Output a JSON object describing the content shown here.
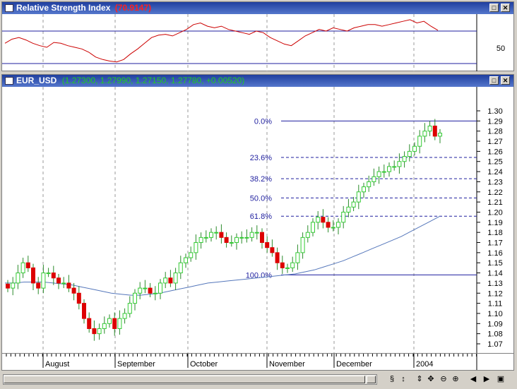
{
  "rsi_pane": {
    "title": "Relative Strength Index",
    "value_text": "(70.9147)",
    "axis_label": "50",
    "buttons": {
      "restore": "□",
      "close": "✕"
    }
  },
  "price_pane": {
    "title": "EUR_USD",
    "quote_text": "(1.27300, 1.27990, 1.27150, 1.27780, +0.00520)",
    "buttons": {
      "restore": "□",
      "close": "✕"
    }
  },
  "chart_data": {
    "type": "candlestick",
    "symbol": "EUR_USD",
    "y_ticks": [
      "1.30",
      "1.29",
      "1.28",
      "1.27",
      "1.26",
      "1.25",
      "1.24",
      "1.23",
      "1.22",
      "1.21",
      "1.20",
      "1.19",
      "1.18",
      "1.17",
      "1.16",
      "1.15",
      "1.14",
      "1.13",
      "1.12",
      "1.11",
      "1.10",
      "1.09",
      "1.08",
      "1.07"
    ],
    "ylim": [
      1.06,
      1.31
    ],
    "x_labels": [
      "August",
      "September",
      "October",
      "November",
      "December",
      "2004"
    ],
    "fibonacci": [
      {
        "label": "0.0%",
        "value": 1.29
      },
      {
        "label": "23.6%",
        "value": 1.254
      },
      {
        "label": "38.2%",
        "value": 1.233
      },
      {
        "label": "50.0%",
        "value": 1.214
      },
      {
        "label": "61.8%",
        "value": 1.196
      },
      {
        "label": "100.0%",
        "value": 1.138
      }
    ],
    "close_series": [
      1.125,
      1.13,
      1.14,
      1.15,
      1.145,
      1.13,
      1.125,
      1.14,
      1.14,
      1.135,
      1.13,
      1.13,
      1.125,
      1.12,
      1.11,
      1.095,
      1.085,
      1.08,
      1.085,
      1.09,
      1.095,
      1.085,
      1.095,
      1.1,
      1.11,
      1.12,
      1.125,
      1.125,
      1.12,
      1.12,
      1.13,
      1.135,
      1.13,
      1.14,
      1.15,
      1.155,
      1.16,
      1.17,
      1.175,
      1.175,
      1.18,
      1.18,
      1.175,
      1.17,
      1.17,
      1.175,
      1.175,
      1.175,
      1.18,
      1.18,
      1.17,
      1.165,
      1.16,
      1.15,
      1.145,
      1.145,
      1.15,
      1.16,
      1.175,
      1.18,
      1.19,
      1.195,
      1.19,
      1.185,
      1.185,
      1.19,
      1.2,
      1.205,
      1.21,
      1.22,
      1.225,
      1.23,
      1.235,
      1.24,
      1.24,
      1.245,
      1.245,
      1.25,
      1.255,
      1.26,
      1.265,
      1.275,
      1.28,
      1.285,
      1.275,
      1.278
    ],
    "ma_series": [
      1.13,
      1.13,
      1.131,
      1.131,
      1.131,
      1.13,
      1.129,
      1.128,
      1.126,
      1.124,
      1.122,
      1.12,
      1.119,
      1.118,
      1.118,
      1.119,
      1.12,
      1.122,
      1.124,
      1.126,
      1.128,
      1.13,
      1.131,
      1.132,
      1.133,
      1.134,
      1.135,
      1.136,
      1.137,
      1.138,
      1.139,
      1.141,
      1.143,
      1.146,
      1.149,
      1.152,
      1.156,
      1.16,
      1.164,
      1.168,
      1.172,
      1.176,
      1.181,
      1.186,
      1.191,
      1.196
    ],
    "rsi_series": [
      55,
      60,
      62,
      59,
      55,
      52,
      50,
      56,
      55,
      52,
      50,
      48,
      44,
      38,
      35,
      33,
      32,
      35,
      42,
      48,
      55,
      62,
      65,
      66,
      64,
      68,
      72,
      78,
      80,
      76,
      74,
      76,
      72,
      70,
      68,
      66,
      70,
      68,
      62,
      58,
      54,
      52,
      58,
      64,
      68,
      72,
      70,
      74,
      72,
      70,
      74,
      76,
      78,
      78,
      76,
      78,
      80,
      82,
      84,
      80,
      82,
      76,
      71
    ],
    "rsi_levels": [
      70,
      30
    ]
  },
  "toolbar": {
    "icons": [
      "cycle-icon",
      "crosshair-icon",
      "vertical-arrows-icon",
      "pan-icon",
      "zoom-out-icon",
      "zoom-in-icon",
      "scroll-left-icon",
      "scroll-right-icon",
      "maximize-icon"
    ],
    "glyphs": [
      "⇕",
      "↕",
      "✥",
      "⊖",
      "⊕",
      "◀",
      "▶",
      "▣",
      "§"
    ]
  }
}
